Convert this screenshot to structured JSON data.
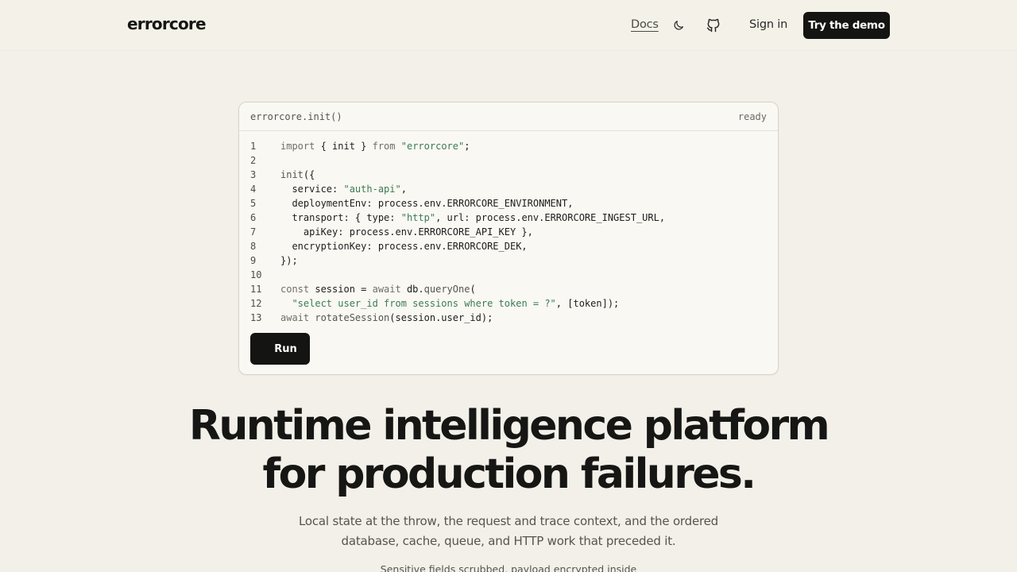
{
  "header": {
    "logo": "errorcore",
    "nav_docs": "Docs",
    "theme_icon": "moon-icon",
    "github_icon": "github-icon",
    "sign_in": "Sign in",
    "cta": "Try the demo"
  },
  "card": {
    "title": "errorcore.init()",
    "status": "ready",
    "run_label": "Run",
    "lines": [
      {
        "n": "1",
        "tokens": [
          [
            "kw",
            "import"
          ],
          [
            "p",
            " { init } "
          ],
          [
            "kw",
            "from"
          ],
          [
            "p",
            " "
          ],
          [
            "str",
            "\"errorcore\""
          ],
          [
            "p",
            ";"
          ]
        ]
      },
      {
        "n": "2",
        "tokens": []
      },
      {
        "n": "3",
        "tokens": [
          [
            "fn",
            "init"
          ],
          [
            "p",
            "({"
          ]
        ]
      },
      {
        "n": "4",
        "tokens": [
          [
            "p",
            "  service: "
          ],
          [
            "str",
            "\"auth-api\""
          ],
          [
            "p",
            ","
          ]
        ]
      },
      {
        "n": "5",
        "tokens": [
          [
            "p",
            "  deploymentEnv: process.env.ERRORCORE_ENVIRONMENT,"
          ]
        ]
      },
      {
        "n": "6",
        "tokens": [
          [
            "p",
            "  transport: { type: "
          ],
          [
            "str",
            "\"http\""
          ],
          [
            "p",
            ", url: process.env.ERRORCORE_INGEST_URL,"
          ]
        ]
      },
      {
        "n": "7",
        "tokens": [
          [
            "p",
            "    apiKey: process.env.ERRORCORE_API_KEY },"
          ]
        ]
      },
      {
        "n": "8",
        "tokens": [
          [
            "p",
            "  encryptionKey: process.env.ERRORCORE_DEK,"
          ]
        ]
      },
      {
        "n": "9",
        "tokens": [
          [
            "p",
            "});"
          ]
        ]
      },
      {
        "n": "10",
        "tokens": []
      },
      {
        "n": "11",
        "tokens": [
          [
            "kw",
            "const"
          ],
          [
            "p",
            " session = "
          ],
          [
            "kw",
            "await"
          ],
          [
            "p",
            " db."
          ],
          [
            "fn",
            "queryOne"
          ],
          [
            "p",
            "("
          ]
        ]
      },
      {
        "n": "12",
        "tokens": [
          [
            "p",
            "  "
          ],
          [
            "str",
            "\"select user_id from sessions where token = ?\""
          ],
          [
            "p",
            ", [token]);"
          ]
        ]
      },
      {
        "n": "13",
        "tokens": [
          [
            "kw",
            "await"
          ],
          [
            "p",
            " "
          ],
          [
            "fn",
            "rotateSession"
          ],
          [
            "p",
            "(session.user_id);"
          ]
        ]
      }
    ]
  },
  "hero": {
    "headline_line1": "Runtime intelligence platform",
    "headline_line2": "for production failures.",
    "sub_line1": "Local state at the throw, the request and trace context, and the ordered",
    "sub_line2": "database, cache, queue, and HTTP work that preceded it.",
    "sub2": "Sensitive fields scrubbed, payload encrypted inside"
  },
  "colors": {
    "background": "#f2f0e8",
    "ink": "#161614",
    "string": "#3c7a52",
    "button": "#141412"
  }
}
